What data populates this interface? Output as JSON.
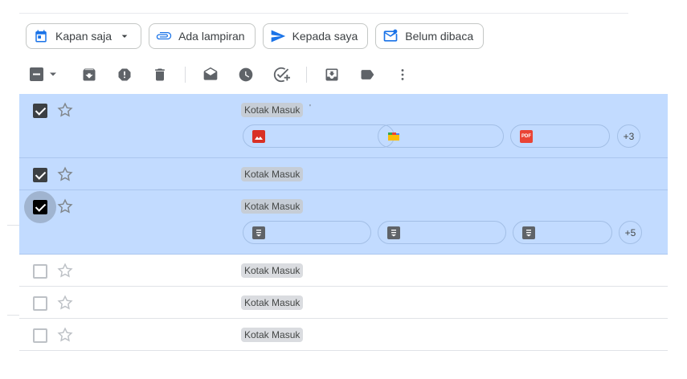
{
  "filters": {
    "anytime": "Kapan saja",
    "has_attachment": "Ada lampiran",
    "to_me": "Kepada saya",
    "unread": "Belum dibaca"
  },
  "colors": {
    "accent": "#1a73e8",
    "selected_row": "#c2dbff",
    "image_icon": "#d93025",
    "pdf_icon": "#ea4335",
    "doc_icon": "#5f6368"
  },
  "rows": [
    {
      "label": "Kotak Masuk",
      "selected": true,
      "tick": "'",
      "more": "+3",
      "attachments": [
        "image-icon",
        "drive-folder-icon",
        "pdf-icon"
      ]
    },
    {
      "label": "Kotak Masuk",
      "selected": true
    },
    {
      "label": "Kotak Masuk",
      "selected": true,
      "more": "+5",
      "attachments": [
        "doc-icon",
        "doc-icon",
        "doc-icon"
      ]
    },
    {
      "label": "Kotak Masuk",
      "selected": false
    },
    {
      "label": "Kotak Masuk",
      "selected": false
    },
    {
      "label": "Kotak Masuk",
      "selected": false
    }
  ],
  "pdf_text": "PDF"
}
